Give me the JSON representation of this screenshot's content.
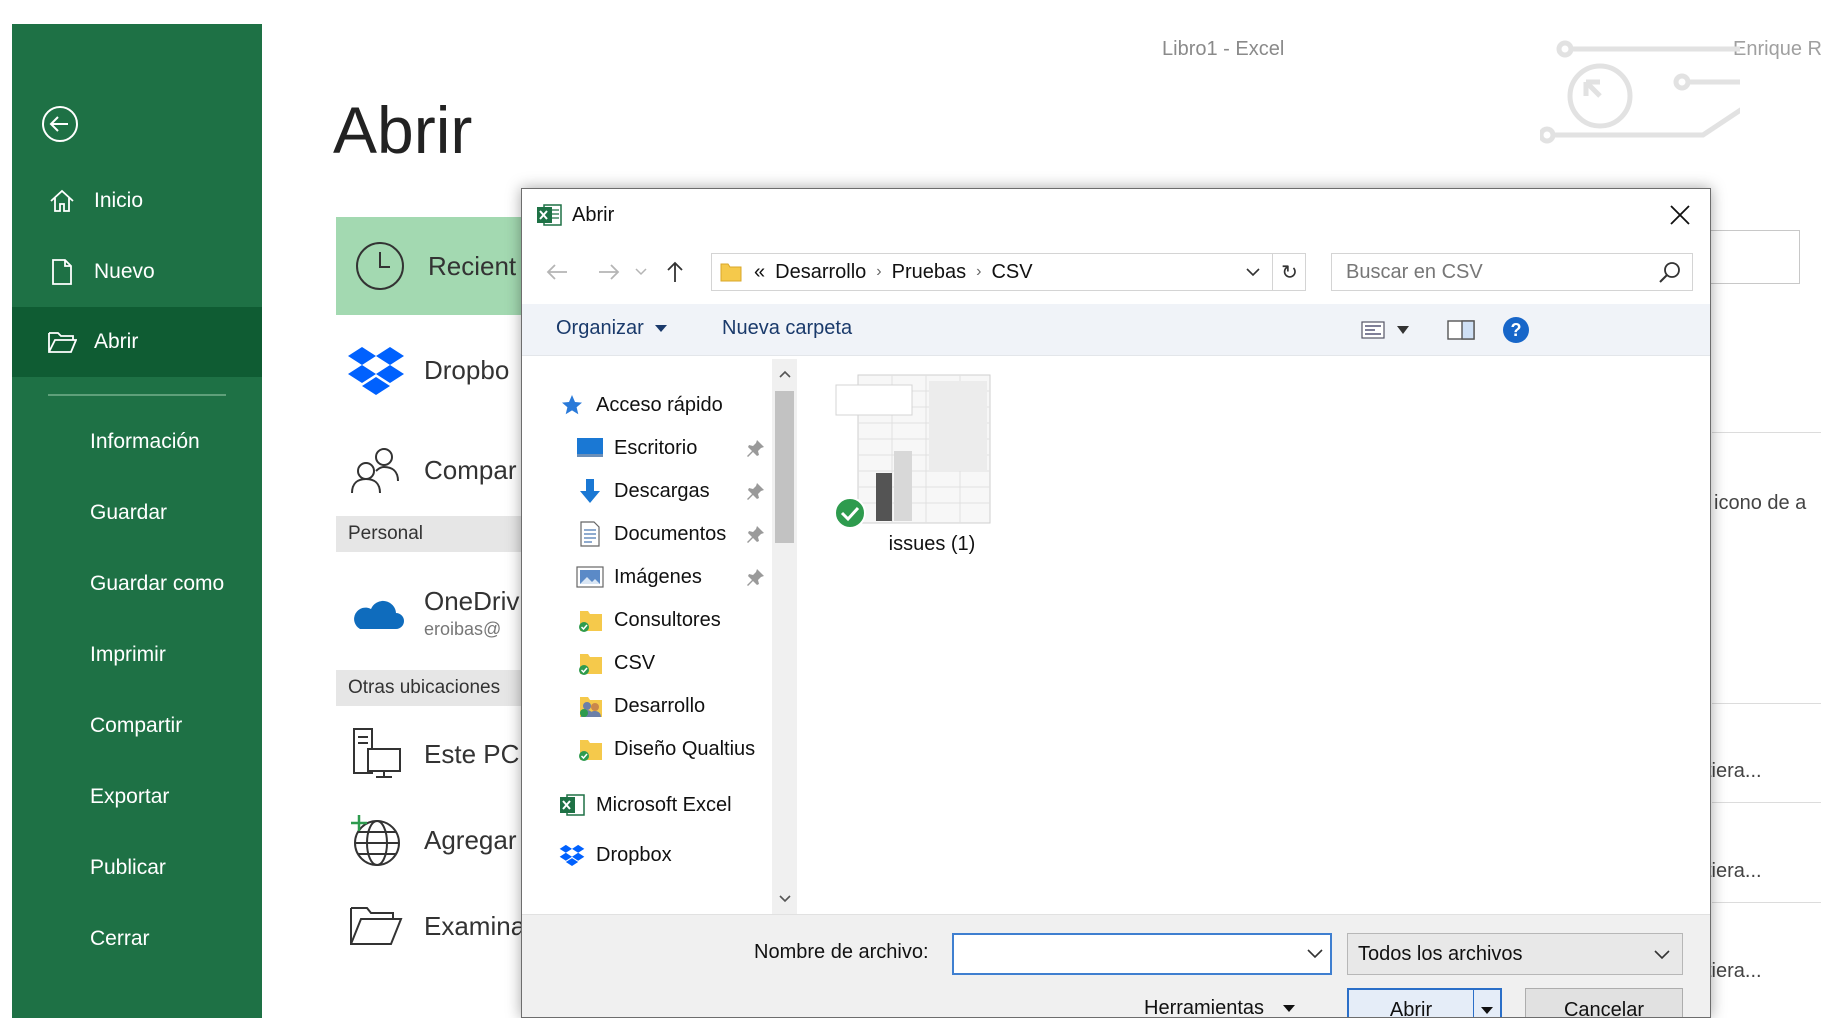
{
  "app": {
    "window_title": "Libro1  -  Excel",
    "user_name": "Enrique R"
  },
  "sidebar": {
    "items": [
      {
        "label": "Inicio",
        "icon": "home-icon"
      },
      {
        "label": "Nuevo",
        "icon": "new-document-icon"
      },
      {
        "label": "Abrir",
        "icon": "open-folder-icon",
        "active": true
      },
      {
        "label": "Información"
      },
      {
        "label": "Guardar"
      },
      {
        "label": "Guardar como"
      },
      {
        "label": "Imprimir"
      },
      {
        "label": "Compartir"
      },
      {
        "label": "Exportar"
      },
      {
        "label": "Publicar"
      },
      {
        "label": "Cerrar"
      }
    ]
  },
  "main": {
    "title": "Abrir",
    "locations": {
      "recent": "Recient",
      "dropbox": "Dropbo",
      "shared": "Compar",
      "personal_header": "Personal",
      "onedrive": "OneDriv",
      "onedrive_account": "eroibas@",
      "other_header": "Otras ubicaciones",
      "this_pc": "Este PC",
      "add_place": "Agregar",
      "browse": "Examina"
    },
    "right_partial": {
      "hint": "l icono de a",
      "item1": "tiera...",
      "item2": "tiera...",
      "item3": "tiera..."
    }
  },
  "dialog": {
    "title": "Abrir",
    "address": {
      "overflow": "«",
      "crumbs": [
        "Desarrollo",
        "Pruebas",
        "CSV"
      ]
    },
    "search_placeholder": "Buscar en CSV",
    "toolbar": {
      "organize": "Organizar",
      "new_folder": "Nueva carpeta"
    },
    "nav": {
      "quick_access": "Acceso rápido",
      "items": [
        "Escritorio",
        "Descargas",
        "Documentos",
        "Imágenes",
        "Consultores",
        "CSV",
        "Desarrollo",
        "Diseño Qualtius"
      ],
      "excel": "Microsoft Excel",
      "dropbox": "Dropbox"
    },
    "files": [
      {
        "name": "issues (1)",
        "icon": "excel-file-thumbnail",
        "status": "synced"
      }
    ],
    "bottom": {
      "filename_label": "Nombre de archivo:",
      "filename_value": "",
      "filetype": "Todos los archivos",
      "tools": "Herramientas",
      "open": "Abrir",
      "cancel": "Cancelar"
    }
  },
  "colors": {
    "sidebar_bg": "#1e7145",
    "sidebar_active": "#0f5c33",
    "recent_highlight": "#a3d9b1",
    "accent_blue": "#2b6fc8"
  }
}
